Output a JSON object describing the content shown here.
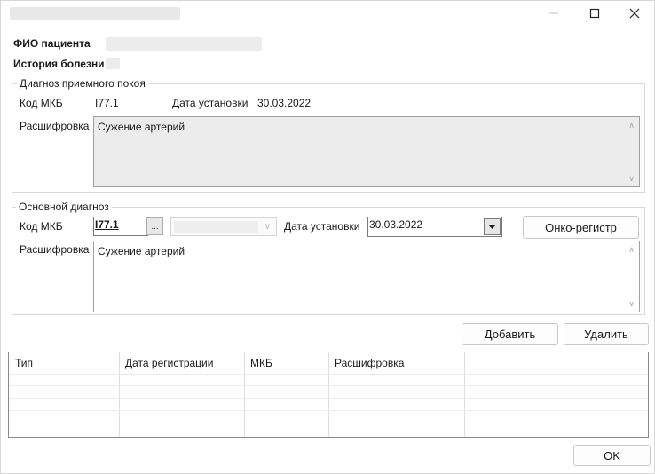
{
  "window": {
    "controls": {
      "minimize": "minimize-icon",
      "maximize": "maximize-icon",
      "close": "close-icon"
    }
  },
  "patient": {
    "fio_label": "ФИО пациента",
    "history_label": "История болезни"
  },
  "reception": {
    "legend": "Диагноз приемного покоя",
    "mkb_label": "Код МКБ",
    "mkb_value": "I77.1",
    "date_label": "Дата установки",
    "date_value": "30.03.2022",
    "decode_label": "Расшифровка",
    "decode_value": "Сужение артерий"
  },
  "main": {
    "legend": "Основной диагноз",
    "mkb_label": "Код МКБ",
    "mkb_value": "I77.1",
    "lookup_label": "...",
    "date_label": "Дата установки",
    "date_value": "30.03.2022",
    "onco_button": "Онко-регистр",
    "decode_label": "Расшифровка",
    "decode_value": "Сужение артерий"
  },
  "actions": {
    "add": "Добавить",
    "delete": "Удалить",
    "ok": "OK"
  },
  "table": {
    "columns": [
      "Тип",
      "Дата регистрации",
      "МКБ",
      "Расшифровка"
    ],
    "rows": []
  }
}
